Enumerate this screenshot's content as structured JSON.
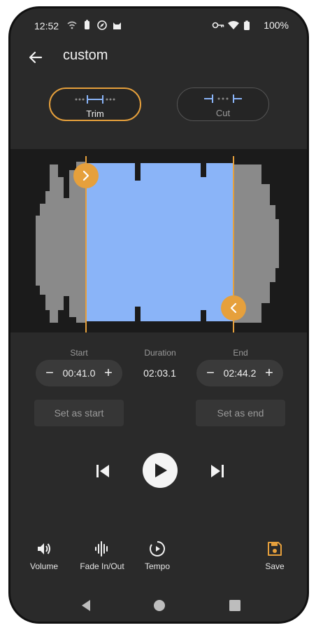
{
  "status_bar": {
    "time": "12:52",
    "battery_text": "100%",
    "icons": [
      "wifi-calling-icon",
      "notification-icon",
      "compass-icon",
      "cat-icon",
      "vpn-key-icon",
      "wifi-icon",
      "battery-icon"
    ]
  },
  "header": {
    "title": "custom",
    "back_icon": "arrow-left-icon"
  },
  "modes": {
    "trim_label": "Trim",
    "cut_label": "Cut",
    "selected": "Trim"
  },
  "colors": {
    "accent": "#e6a03c",
    "selection": "#8ab4f8",
    "waveform_unselected": "#8a8a8a",
    "background": "#2a2a2a"
  },
  "waveform": {
    "selection_start_fraction": 0.25,
    "selection_end_fraction": 0.75
  },
  "times": {
    "start_label": "Start",
    "start_value": "00:41.0",
    "duration_label": "Duration",
    "duration_value": "02:03.1",
    "end_label": "End",
    "end_value": "02:44.2",
    "minus": "−",
    "plus": "+"
  },
  "actions": {
    "set_start": "Set as start",
    "set_end": "Set as end"
  },
  "toolbar": {
    "volume": "Volume",
    "fade": "Fade In/Out",
    "tempo": "Tempo",
    "save": "Save"
  }
}
